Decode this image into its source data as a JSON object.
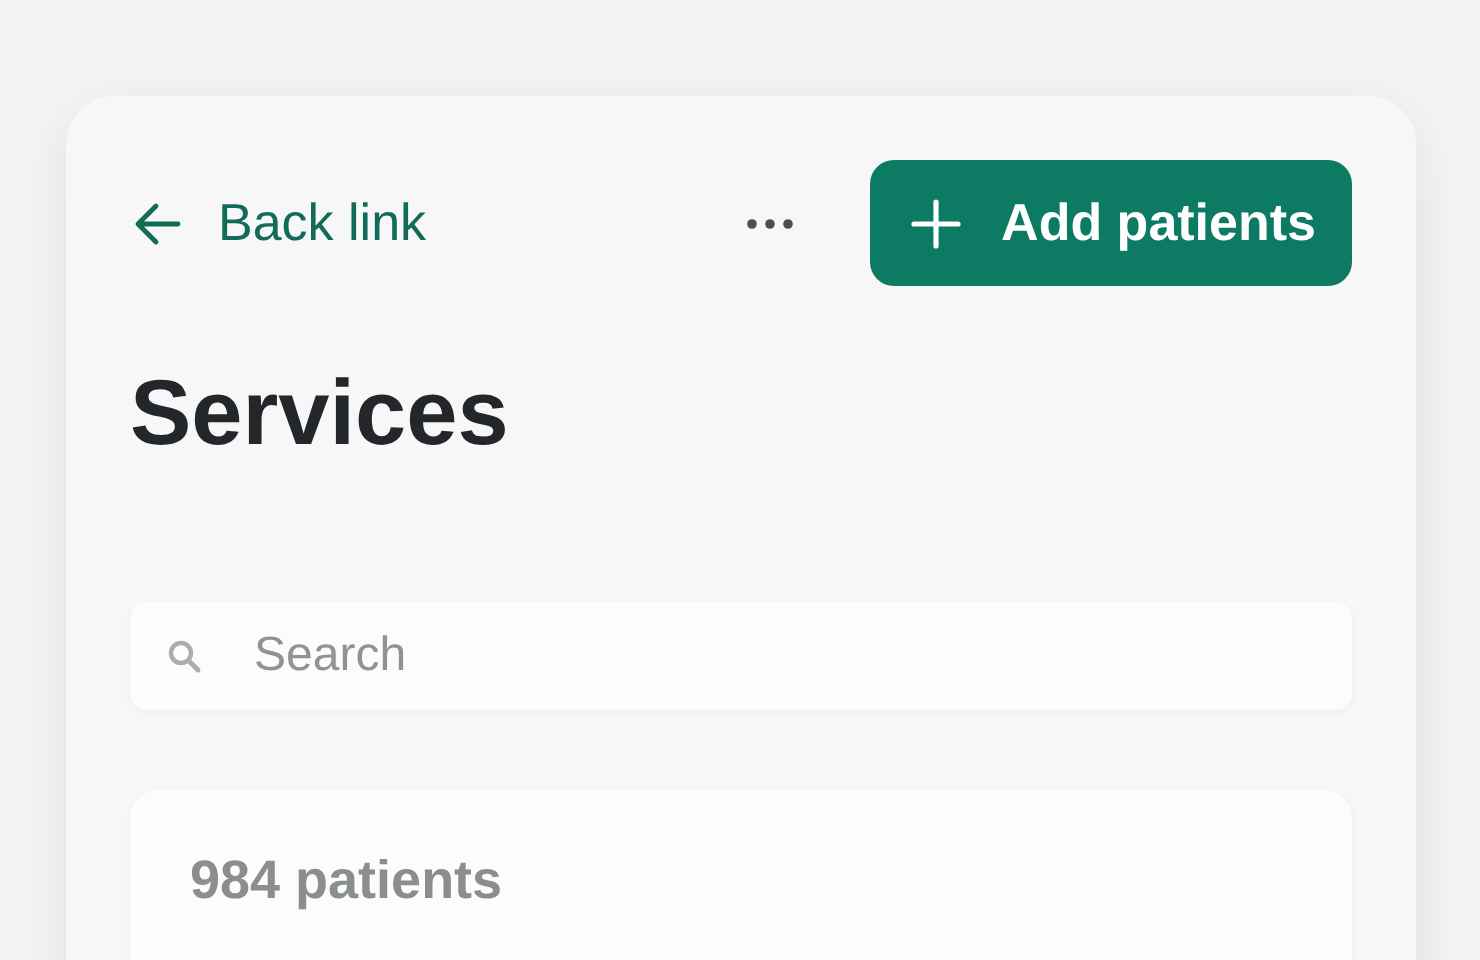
{
  "header": {
    "back_link": "Back link",
    "add_button": "Add patients"
  },
  "title": "Services",
  "search": {
    "placeholder": "Search"
  },
  "summary": {
    "count": "984 patients"
  }
}
